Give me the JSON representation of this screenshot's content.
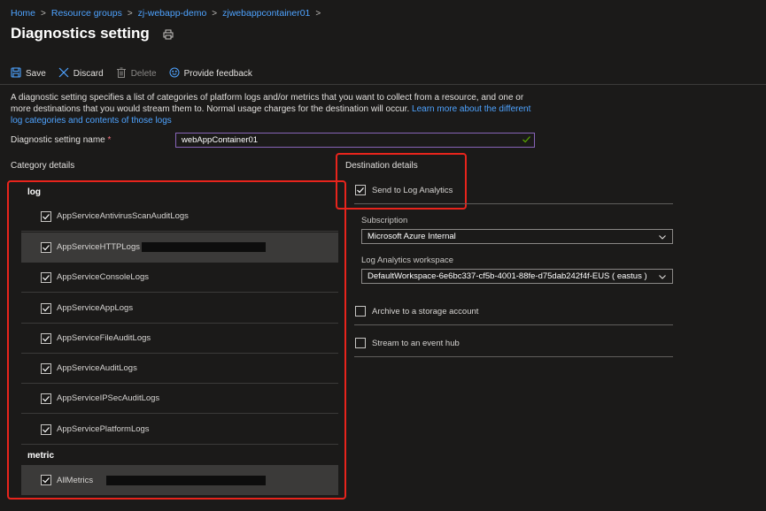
{
  "breadcrumb": {
    "items": [
      "Home",
      "Resource groups",
      "zj-webapp-demo",
      "zjwebappcontainer01"
    ],
    "separator": ">"
  },
  "page": {
    "title": "Diagnostics setting"
  },
  "toolbar": {
    "save": "Save",
    "discard": "Discard",
    "delete": "Delete",
    "feedback": "Provide feedback"
  },
  "description": {
    "text": "A diagnostic setting specifies a list of categories of platform logs and/or metrics that you want to collect from a resource, and one or more destinations that you would stream them to. Normal usage charges for the destination will occur. ",
    "link": "Learn more about the different log categories and contents of those logs"
  },
  "setting_name": {
    "label": "Diagnostic setting name",
    "required_mark": "*",
    "value": "webAppContainer01"
  },
  "category_details": {
    "title": "Category details",
    "log_heading": "log",
    "logs": [
      {
        "label": "AppServiceAntivirusScanAuditLogs",
        "checked": true
      },
      {
        "label": "AppServiceHTTPLogs",
        "checked": true
      },
      {
        "label": "AppServiceConsoleLogs",
        "checked": true
      },
      {
        "label": "AppServiceAppLogs",
        "checked": true
      },
      {
        "label": "AppServiceFileAuditLogs",
        "checked": true
      },
      {
        "label": "AppServiceAuditLogs",
        "checked": true
      },
      {
        "label": "AppServiceIPSecAuditLogs",
        "checked": true
      },
      {
        "label": "AppServicePlatformLogs",
        "checked": true
      }
    ],
    "metric_heading": "metric",
    "metrics": [
      {
        "label": "AllMetrics",
        "checked": true
      }
    ]
  },
  "destination_details": {
    "title": "Destination details",
    "send_to_log_analytics": {
      "label": "Send to Log Analytics",
      "checked": true
    },
    "subscription_label": "Subscription",
    "subscription_value": "Microsoft Azure Internal",
    "workspace_label": "Log Analytics workspace",
    "workspace_value": "DefaultWorkspace-6e6bc337-cf5b-4001-88fe-d75dab242f4f-EUS ( eastus )",
    "archive": {
      "label": "Archive to a storage account",
      "checked": false
    },
    "event_hub": {
      "label": "Stream to an event hub",
      "checked": false
    }
  },
  "colors": {
    "background": "#1b1a19",
    "link": "#4ea3ff",
    "highlight_box": "#e8241c",
    "input_border_focus": "#8764b8",
    "valid_check": "#57a300"
  },
  "icons": [
    "save-icon",
    "discard-icon",
    "delete-icon",
    "feedback-icon",
    "print-icon",
    "checkmark-icon",
    "chevron-down-icon"
  ]
}
